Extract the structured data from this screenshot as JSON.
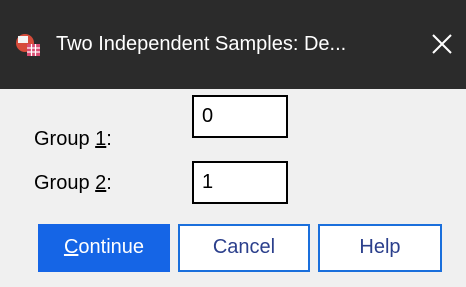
{
  "window": {
    "title": "Two Independent Samples: De...",
    "icon": "spss-dialog-icon",
    "close_glyph": "✕"
  },
  "groups": [
    {
      "label_prefix": "Group ",
      "label_key": "1",
      "label_suffix": ":",
      "value": "0"
    },
    {
      "label_prefix": "Group ",
      "label_key": "2",
      "label_suffix": ":",
      "value": "1"
    }
  ],
  "buttons": {
    "continue": {
      "mnemonic": "C",
      "rest": "ontinue"
    },
    "cancel": "Cancel",
    "help": "Help"
  },
  "colors": {
    "titlebar": "#2b2b2b",
    "primary": "#1565e6",
    "border_accent": "#1a6fdc"
  }
}
